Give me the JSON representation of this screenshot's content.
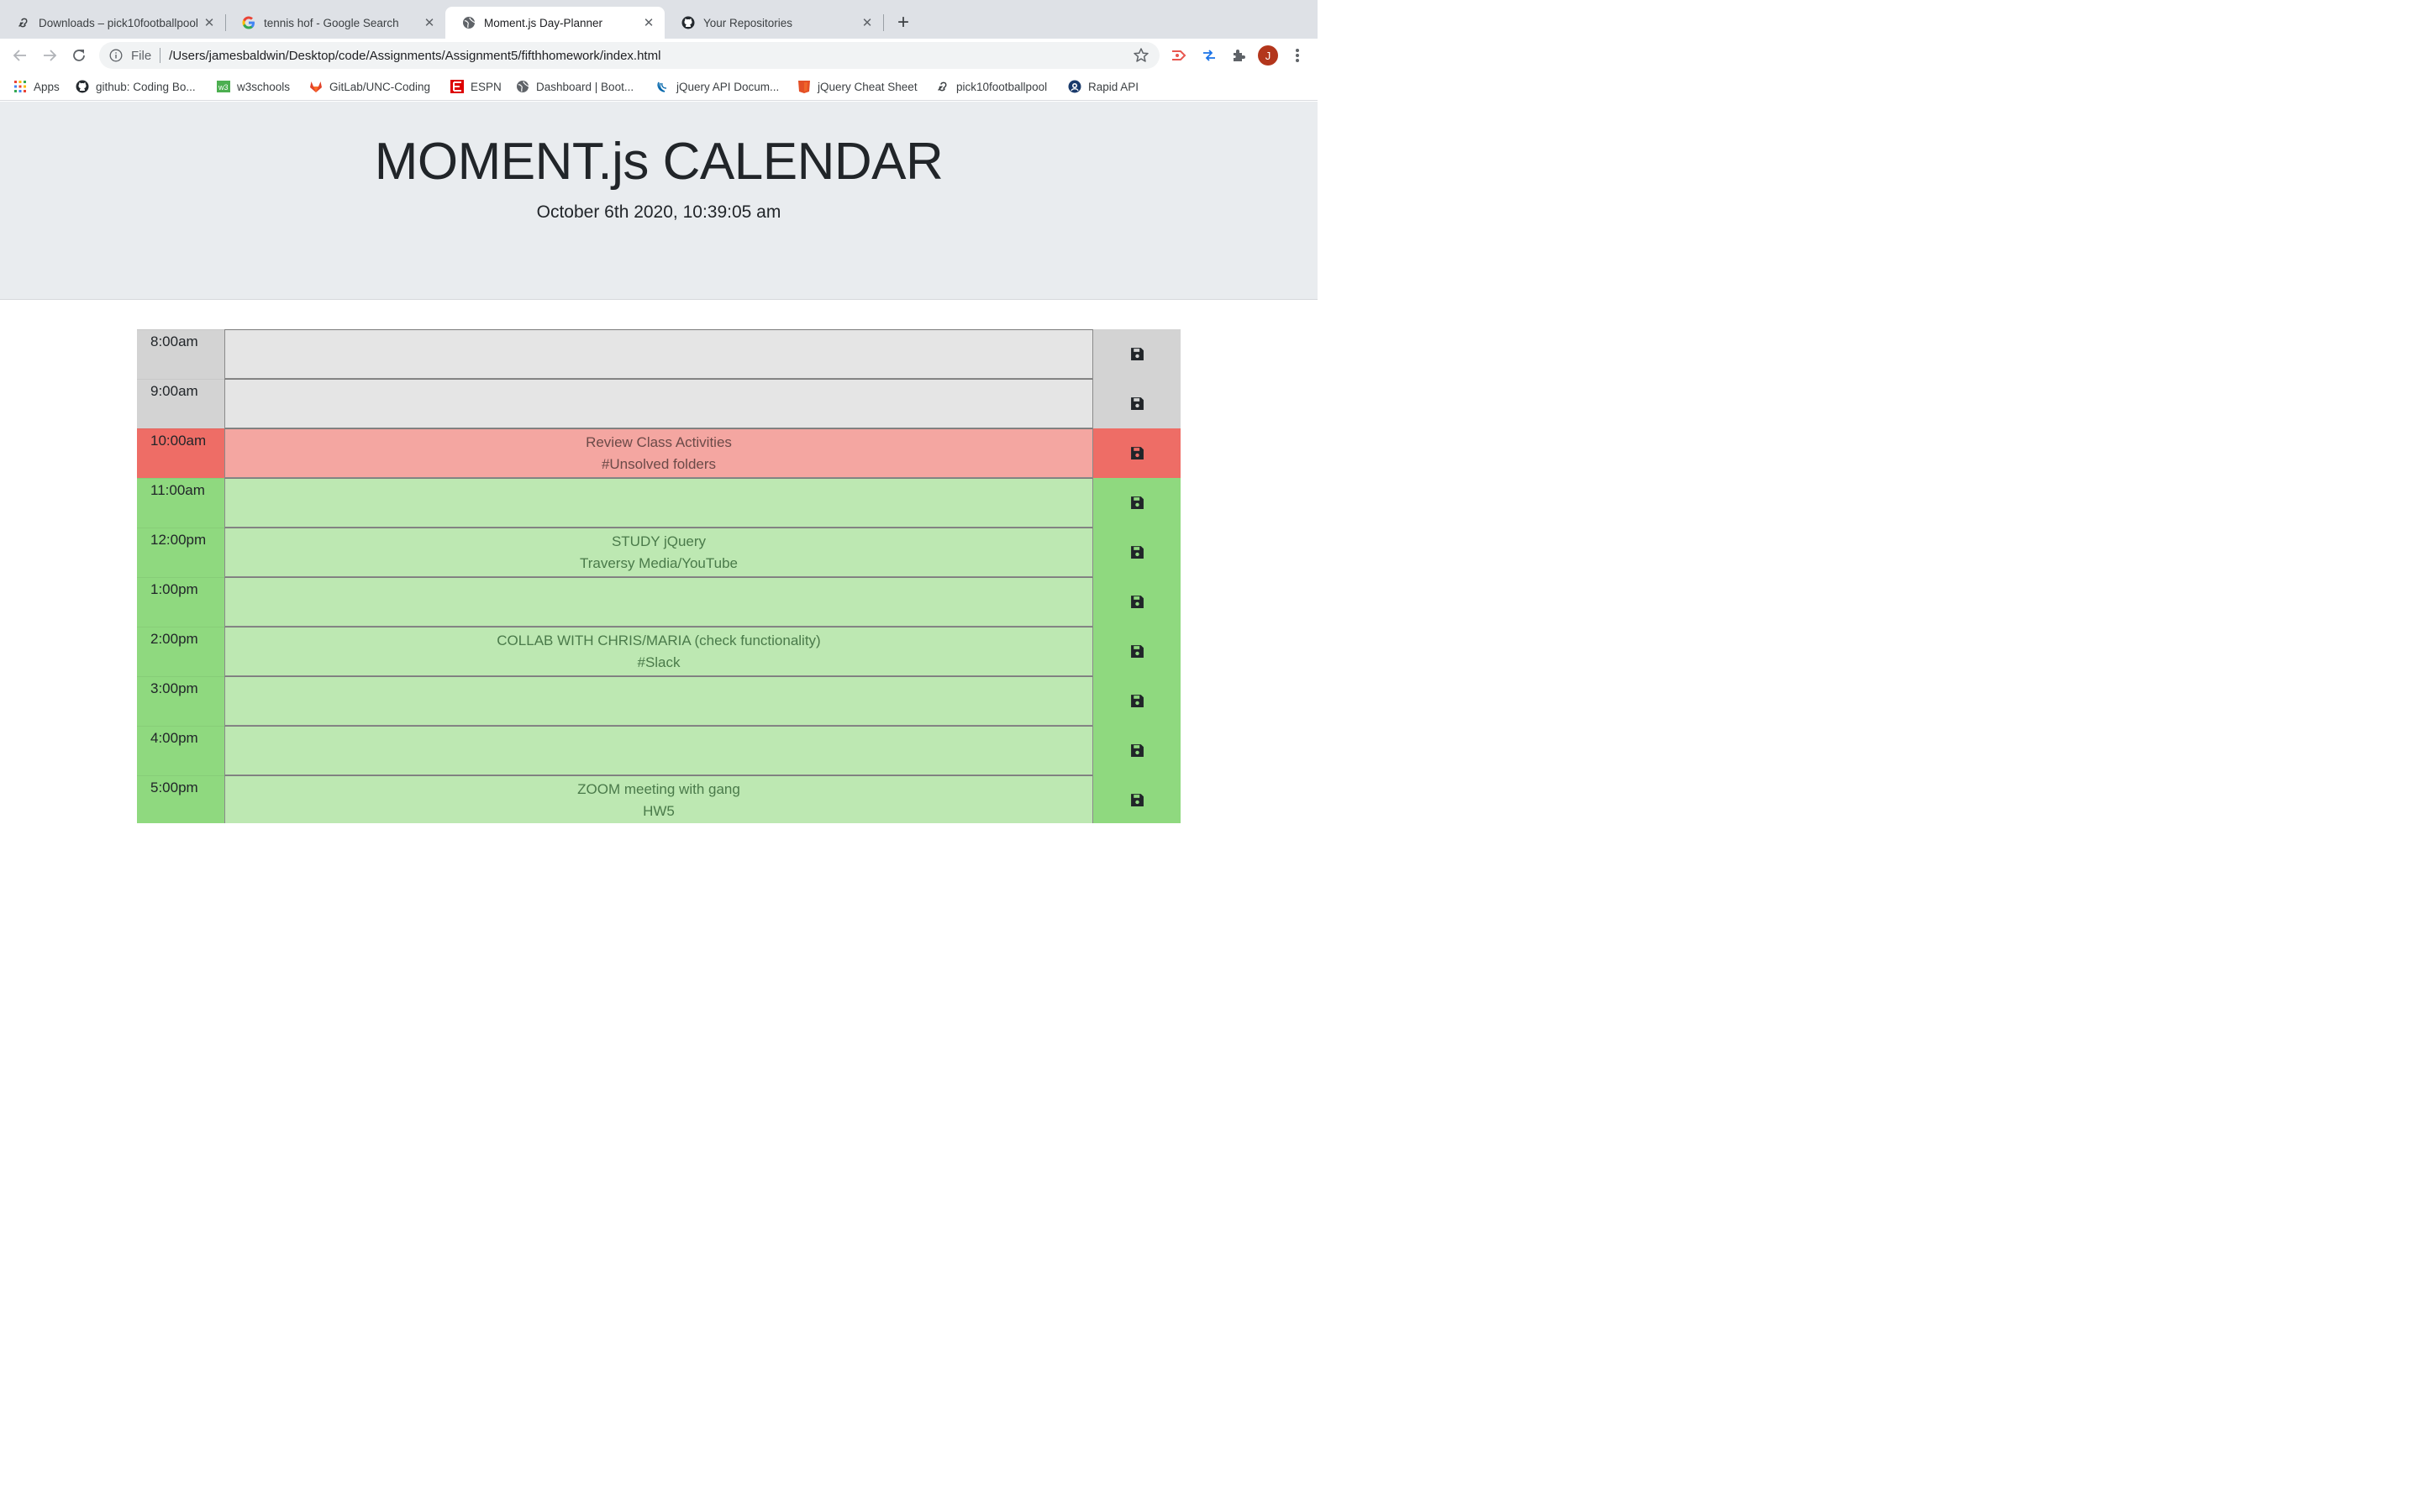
{
  "browser": {
    "tabs": [
      {
        "title": "Downloads – pick10footballpool",
        "icon": "link-icon",
        "active": false
      },
      {
        "title": "tennis hof - Google Search",
        "icon": "google-icon",
        "active": false
      },
      {
        "title": "Moment.js Day-Planner",
        "icon": "globe-icon",
        "active": true
      },
      {
        "title": "Your Repositories",
        "icon": "github-icon",
        "active": false
      }
    ],
    "address": {
      "scheme": "File",
      "url": "/Users/jamesbaldwin/Desktop/code/Assignments/Assignment5/fifthhomework/index.html"
    },
    "profile_initial": "J",
    "bookmarks": [
      {
        "label": "Apps",
        "icon": "apps-grid-icon"
      },
      {
        "label": "github: Coding Bo...",
        "icon": "github-icon"
      },
      {
        "label": "w3schools",
        "icon": "w3schools-icon"
      },
      {
        "label": "GitLab/UNC-Coding",
        "icon": "gitlab-icon"
      },
      {
        "label": "ESPN",
        "icon": "espn-icon"
      },
      {
        "label": "Dashboard | Boot...",
        "icon": "globe-icon"
      },
      {
        "label": "jQuery API Docum...",
        "icon": "jquery-icon"
      },
      {
        "label": "jQuery Cheat Sheet",
        "icon": "html5-icon"
      },
      {
        "label": "pick10footballpool",
        "icon": "link-icon"
      },
      {
        "label": "Rapid API",
        "icon": "rapidapi-icon"
      }
    ]
  },
  "header": {
    "title": "MOMENT.js CALENDAR",
    "current_datetime": "October 6th 2020, 10:39:05 am"
  },
  "colors": {
    "past": "#d3d3d3",
    "present": "#ee6d66",
    "future": "#8fd97f"
  },
  "planner": {
    "rows": [
      {
        "hour": "8:00am",
        "status": "past",
        "lines": []
      },
      {
        "hour": "9:00am",
        "status": "past",
        "lines": []
      },
      {
        "hour": "10:00am",
        "status": "present",
        "lines": [
          "Review Class Activities",
          "#Unsolved folders"
        ]
      },
      {
        "hour": "11:00am",
        "status": "future",
        "lines": []
      },
      {
        "hour": "12:00pm",
        "status": "future",
        "lines": [
          "STUDY jQuery",
          "Traversy Media/YouTube"
        ]
      },
      {
        "hour": "1:00pm",
        "status": "future",
        "lines": []
      },
      {
        "hour": "2:00pm",
        "status": "future",
        "lines": [
          "COLLAB WITH CHRIS/MARIA (check functionality)",
          "#Slack"
        ]
      },
      {
        "hour": "3:00pm",
        "status": "future",
        "lines": []
      },
      {
        "hour": "4:00pm",
        "status": "future",
        "lines": []
      },
      {
        "hour": "5:00pm",
        "status": "future",
        "lines": [
          "ZOOM meeting with gang",
          "HW5"
        ]
      }
    ],
    "save_icon": "floppy-disk-icon"
  }
}
